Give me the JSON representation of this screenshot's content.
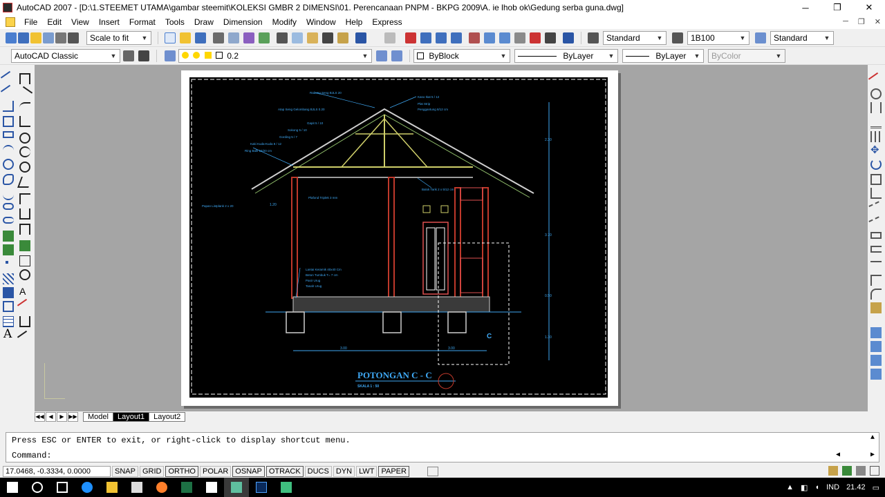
{
  "window": {
    "title": "AutoCAD 2007 - [D:\\1.STEEMET UTAMA\\gambar steemit\\KOLEKSI GMBR 2 DIMENSI\\01. Perencanaan PNPM - BKPG 2009\\A. ie lhob ok\\Gedung serba guna.dwg]",
    "minimize": "─",
    "restore": "❐",
    "close": "✕"
  },
  "menu": [
    "File",
    "Edit",
    "View",
    "Insert",
    "Format",
    "Tools",
    "Draw",
    "Dimension",
    "Modify",
    "Window",
    "Help",
    "Express"
  ],
  "toolbar1": {
    "plot_scale": "Scale to fit",
    "text_style": "Standard",
    "dim_style": "1B100",
    "table_style": "Standard"
  },
  "toolbar2": {
    "workspace": "AutoCAD Classic",
    "layer": "0.2",
    "color": "ByBlock",
    "linetype": "ByLayer",
    "lineweight": "ByLayer",
    "plotstyle": "ByColor"
  },
  "drawing": {
    "title": "POTONGAN C - C",
    "scale": "SKALA  1 : 50",
    "marker": "C",
    "labels": [
      "Rabung Seng BJLS 20",
      "Kaso Ikat 5 / 12",
      "Atap Seng Gelombang BJLS 0.20",
      "Plat Strip",
      "Penggantung 8/12 cm",
      "Gapit 5 / 10",
      "Sokong 5 / 10",
      "Gording  5 / 7",
      "Kaki Kuda-Kuda 8 / 12",
      "Ring Balk 15/20 cm",
      "Balok Tarik 2 x  5/12 cm",
      "Papan Listplank  2 x 20",
      "Plafond Triplek 3 mm",
      "Lantai Keramik 40x40 Cm",
      "Beton Tumbuk T= 7 cm",
      "Pasir Urug",
      "Tanah Urug"
    ],
    "dims_right": [
      "2.30",
      "3.70",
      "0.50",
      "1.30"
    ],
    "dims_bottom": [
      "3.00",
      "3.00"
    ],
    "dim_left": "1.20"
  },
  "sheet_tabs": [
    "Model",
    "Layout1",
    "Layout2"
  ],
  "active_tab": "Layout1",
  "command": {
    "history": "Press ESC or ENTER to exit, or right-click to display shortcut menu.",
    "prompt": "Command:"
  },
  "status": {
    "coords": "17.0468, -0.3334, 0.0000",
    "toggles": [
      "SNAP",
      "GRID",
      "ORTHO",
      "POLAR",
      "OSNAP",
      "OTRACK",
      "DUCS",
      "DYN",
      "LWT",
      "PAPER"
    ]
  },
  "taskbar": {
    "language": "IND",
    "time": "21.42"
  },
  "colors": {
    "accent_cyan": "#3fa9f5",
    "cad_background": "#000000",
    "paper": "#ffffff",
    "wall_red": "#c0392b"
  }
}
